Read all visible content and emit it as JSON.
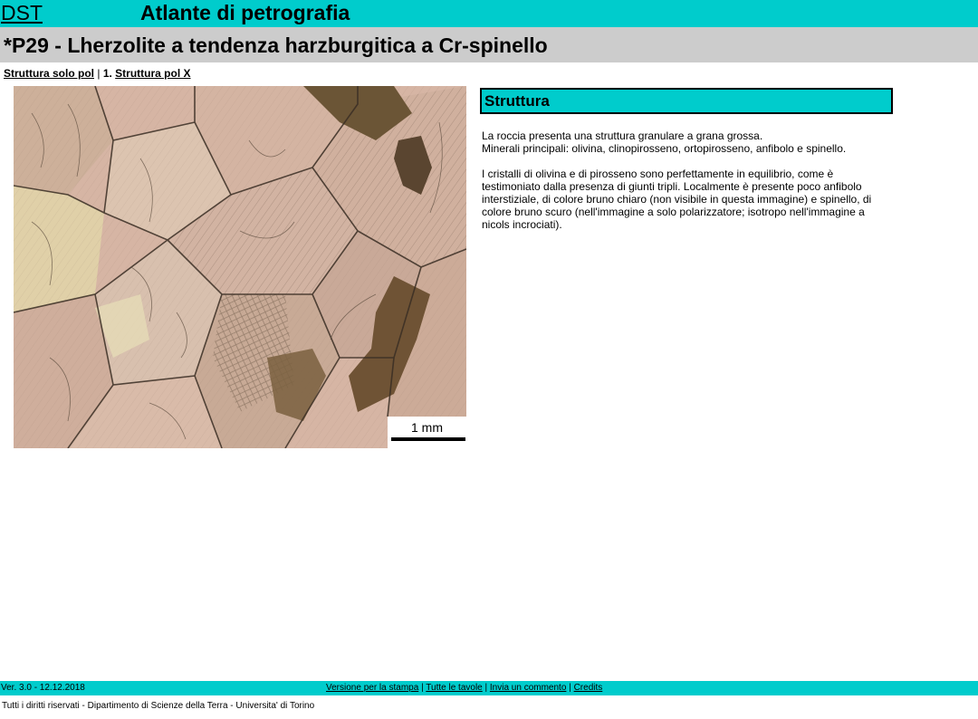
{
  "header": {
    "dst_link": "DST",
    "site_title": "Atlante di petrografia",
    "page_title": "*P29 - Lherzolite a tendenza harzburgitica a Cr-spinello"
  },
  "subnav": {
    "link1": "Struttura solo pol",
    "separator": "|",
    "current_prefix": "1.",
    "link2": "Struttura pol X"
  },
  "image": {
    "scale_label": "1 mm"
  },
  "section": {
    "title": "Struttura",
    "line1": "La roccia presenta una struttura granulare a grana grossa.",
    "line2": "Minerali principali: olivina, clinopirosseno, ortopirosseno, anfibolo e spinello.",
    "paragraph2": "I cristalli di olivina e di pirosseno sono perfettamente in equilibrio, come è testimoniato dalla presenza di giunti tripli. Localmente è presente poco anfibolo interstiziale, di colore bruno chiaro (non visibile in questa immagine) e spinello, di colore bruno scuro (nell'immagine a solo polarizzatore; isotropo nell'immagine a nicols incrociati)."
  },
  "footer": {
    "version": "Ver. 3.0 - 12.12.2018",
    "links": [
      "Versione per la stampa",
      "Tutte le tavole",
      "Invia un commento",
      "Credits"
    ],
    "separator": "|",
    "copyright": "Tutti i diritti riservati - Dipartimento di Scienze della Terra - Universita' di Torino"
  },
  "colors": {
    "accent": "#00cccc",
    "title_band": "#cccccc"
  }
}
